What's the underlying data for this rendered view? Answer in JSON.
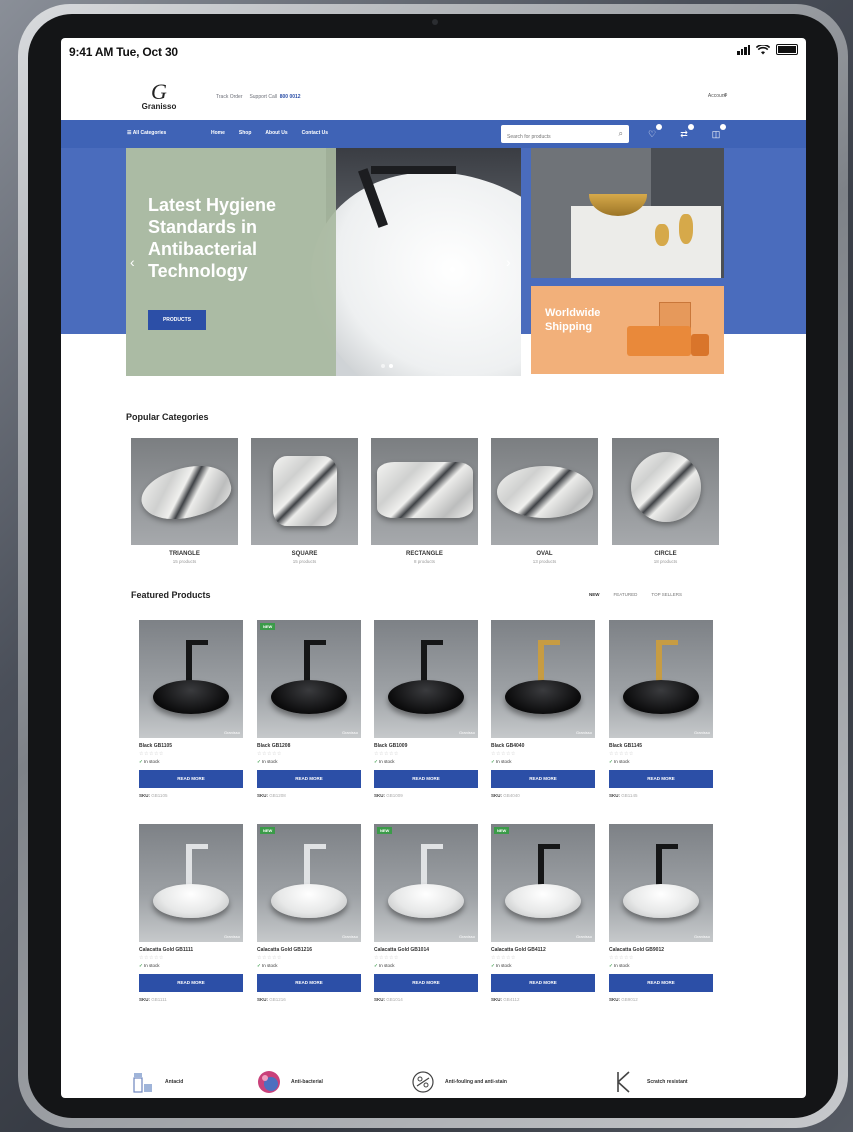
{
  "status": {
    "time": "9:41 AM Tue, Oct 30"
  },
  "site": {
    "logo_mark": "G",
    "logo_text": "Granisso",
    "top_info": "Track Order",
    "top_info_support": "Support Call",
    "top_info_number": "800 0012",
    "account": "Account"
  },
  "nav": {
    "all_categories": "All Categories",
    "links": [
      "Home",
      "Shop",
      "About Us",
      "Contact Us"
    ],
    "search_placeholder": "Search for products",
    "icons": [
      "heart-icon",
      "compare-icon",
      "cart-icon"
    ]
  },
  "hero": {
    "headline": "Latest Hygiene Standards in Antibacterial Technology",
    "cta": "PRODUCTS",
    "side_banner": "Worldwide Shipping"
  },
  "categories": {
    "title": "Popular Categories",
    "items": [
      {
        "name": "TRIANGLE",
        "count": "15 products"
      },
      {
        "name": "SQUARE",
        "count": "15 products"
      },
      {
        "name": "RECTANGLE",
        "count": "8 products"
      },
      {
        "name": "OVAL",
        "count": "13 products"
      },
      {
        "name": "CIRCLE",
        "count": "18 products"
      }
    ]
  },
  "featured": {
    "title": "Featured Products",
    "tabs": [
      "NEW",
      "FEATURED",
      "TOP SELLERS"
    ],
    "products": [
      {
        "name": "Black GB1105",
        "stock": "In stock",
        "button": "READ MORE",
        "sku_label": "SKU:",
        "sku": "GB1105",
        "new": false,
        "finish": "black",
        "tap": "black"
      },
      {
        "name": "Black GB1208",
        "stock": "In stock",
        "button": "READ MORE",
        "sku_label": "SKU:",
        "sku": "GB1208",
        "new": true,
        "finish": "black",
        "tap": "black"
      },
      {
        "name": "Black GB1009",
        "stock": "In stock",
        "button": "READ MORE",
        "sku_label": "SKU:",
        "sku": "GB1009",
        "new": false,
        "finish": "black",
        "tap": "black"
      },
      {
        "name": "Black GB4040",
        "stock": "In stock",
        "button": "READ MORE",
        "sku_label": "SKU:",
        "sku": "GB4040",
        "new": false,
        "finish": "black",
        "tap": "gold"
      },
      {
        "name": "Black GB1145",
        "stock": "In stock",
        "button": "READ MORE",
        "sku_label": "SKU:",
        "sku": "GB1145",
        "new": false,
        "finish": "black",
        "tap": "gold"
      },
      {
        "name": "Calacatta Gold GB1111",
        "stock": "In stock",
        "button": "READ MORE",
        "sku_label": "SKU:",
        "sku": "GB1111",
        "new": false,
        "finish": "white",
        "tap": "silver"
      },
      {
        "name": "Calacatta Gold GB1216",
        "stock": "In stock",
        "button": "READ MORE",
        "sku_label": "SKU:",
        "sku": "GB1216",
        "new": true,
        "finish": "white",
        "tap": "silver"
      },
      {
        "name": "Calacatta Gold GB1014",
        "stock": "In stock",
        "button": "READ MORE",
        "sku_label": "SKU:",
        "sku": "GB1014",
        "new": true,
        "finish": "white",
        "tap": "silver"
      },
      {
        "name": "Calacatta Gold GB4112",
        "stock": "In stock",
        "button": "READ MORE",
        "sku_label": "SKU:",
        "sku": "GB4112",
        "new": true,
        "finish": "white",
        "tap": "black"
      },
      {
        "name": "Calacatta Gold GB9012",
        "stock": "In stock",
        "button": "READ MORE",
        "sku_label": "SKU:",
        "sku": "GB9012",
        "new": false,
        "finish": "white",
        "tap": "black"
      }
    ],
    "rating": "☆☆☆☆☆",
    "brand": "Granisso"
  },
  "features": [
    {
      "label": "Antacid",
      "icon": "drop-icon"
    },
    {
      "label": "Anti-bacterial",
      "icon": "bacteria-icon"
    },
    {
      "label": "Anti-fouling and anti-stain",
      "icon": "stain-icon"
    },
    {
      "label": "Scratch resistant",
      "icon": "scratch-icon"
    }
  ],
  "colors": {
    "brand_blue": "#3f63b6",
    "button_blue": "#2c4fa7",
    "badge_green": "#3b9b49",
    "hero_panel": "#a8b9a0",
    "shipping_banner": "#f2b07a"
  }
}
